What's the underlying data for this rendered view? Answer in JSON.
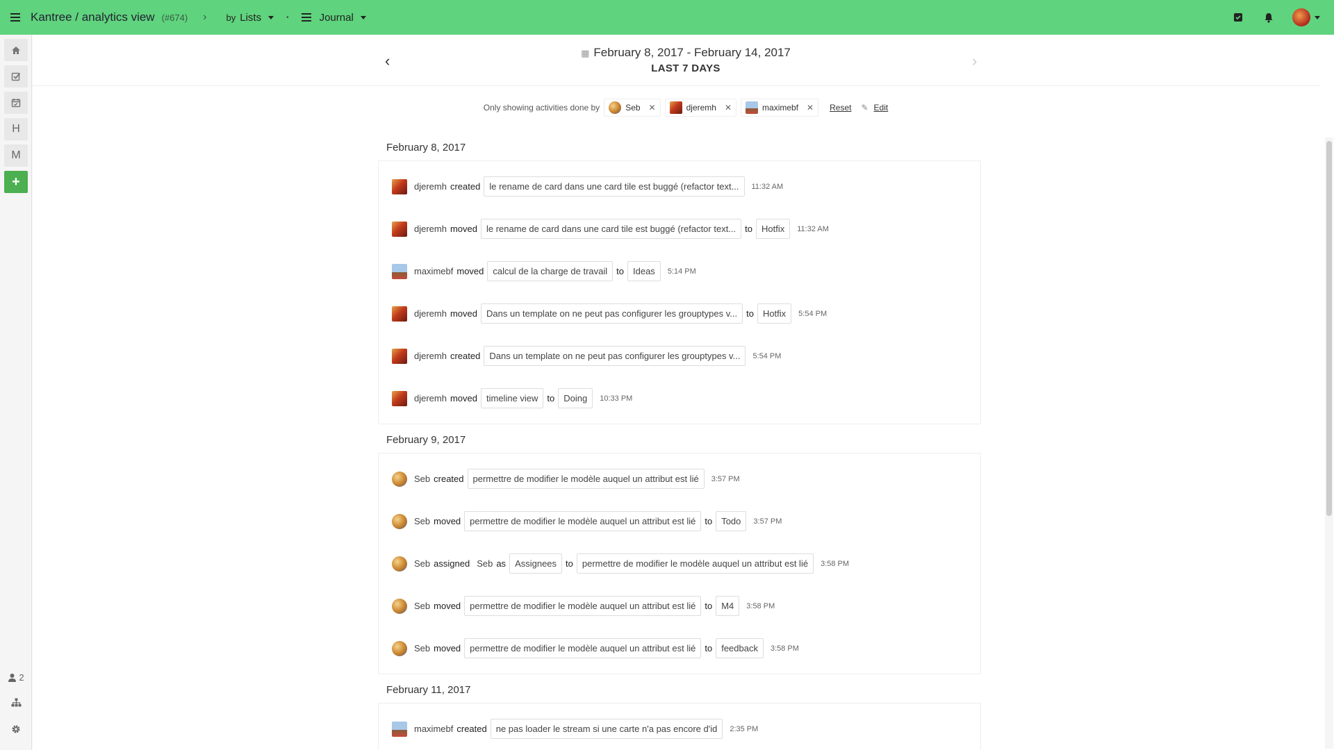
{
  "topbar": {
    "board_title": "Kantree / analytics view",
    "board_num": "(#674)",
    "group_prefix": "by",
    "group_label": "Lists",
    "view_label": "Journal"
  },
  "sidebar": {
    "items": [
      "home",
      "tasks",
      "calendar",
      "H",
      "M",
      "+"
    ],
    "members_count": "2"
  },
  "header": {
    "range": "February 8, 2017 - February 14, 2017",
    "range_sub": "LAST 7 DAYS"
  },
  "filter": {
    "label": "Only showing activities done by",
    "users": [
      "Seb",
      "djeremh",
      "maximebf"
    ],
    "reset": "Reset",
    "edit": "Edit"
  },
  "days": [
    {
      "title": "February 8, 2017",
      "items": [
        {
          "user": "djeremh",
          "avatar": "dj",
          "verb": "created",
          "card": "le rename de card dans une card tile est buggé (refactor text...",
          "time": "11:32 AM"
        },
        {
          "user": "djeremh",
          "avatar": "dj",
          "verb": "moved",
          "card": "le rename de card dans une card tile est buggé (refactor text...",
          "to": "to",
          "target": "Hotfix",
          "time": "11:32 AM"
        },
        {
          "user": "maximebf",
          "avatar": "mx",
          "verb": "moved",
          "card": "calcul de la charge de travail",
          "to": "to",
          "target": "Ideas",
          "time": "5:14 PM"
        },
        {
          "user": "djeremh",
          "avatar": "dj",
          "verb": "moved",
          "card": "Dans un template on ne peut pas configurer les grouptypes v...",
          "to": "to",
          "target": "Hotfix",
          "time": "5:54 PM"
        },
        {
          "user": "djeremh",
          "avatar": "dj",
          "verb": "created",
          "card": "Dans un template on ne peut pas configurer les grouptypes v...",
          "time": "5:54 PM"
        },
        {
          "user": "djeremh",
          "avatar": "dj",
          "verb": "moved",
          "card": "timeline view",
          "to": "to",
          "target": "Doing",
          "time": "10:33 PM"
        }
      ]
    },
    {
      "title": "February 9, 2017",
      "items": [
        {
          "user": "Seb",
          "avatar": "seb",
          "verb": "created",
          "card": "permettre de modifier le modèle auquel un attribut est lié",
          "time": "3:57 PM"
        },
        {
          "user": "Seb",
          "avatar": "seb",
          "verb": "moved",
          "card": "permettre de modifier le modèle auquel un attribut est lié",
          "to": "to",
          "target": "Todo",
          "time": "3:57 PM"
        },
        {
          "user": "Seb",
          "avatar": "seb",
          "verb": "assigned",
          "assignee": "Seb",
          "as": "as",
          "field": "Assignees",
          "to": "to",
          "card": "permettre de modifier le modèle auquel un attribut est lié",
          "time": "3:58 PM"
        },
        {
          "user": "Seb",
          "avatar": "seb",
          "verb": "moved",
          "card": "permettre de modifier le modèle auquel un attribut est lié",
          "to": "to",
          "target": "M4",
          "time": "3:58 PM"
        },
        {
          "user": "Seb",
          "avatar": "seb",
          "verb": "moved",
          "card": "permettre de modifier le modèle auquel un attribut est lié",
          "to": "to",
          "target": "feedback",
          "time": "3:58 PM"
        }
      ]
    },
    {
      "title": "February 11, 2017",
      "items": [
        {
          "user": "maximebf",
          "avatar": "mx",
          "verb": "created",
          "card": "ne pas loader le stream si une carte n'a pas encore d'id",
          "time": "2:35 PM"
        }
      ]
    }
  ],
  "colors": {
    "topbar": "#5fd37d",
    "add_button": "#4caf50"
  }
}
